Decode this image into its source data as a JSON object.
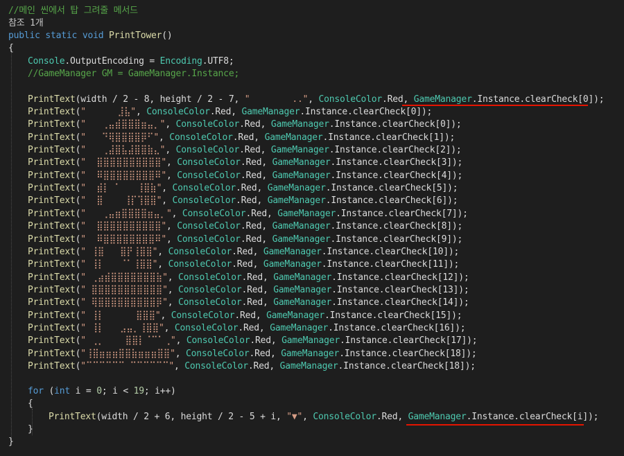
{
  "code": {
    "comment_header": "//메인 씬에서 탑 그려줄 메서드",
    "reference_count": "참조 1개",
    "signature": {
      "public": "public",
      "static": "static",
      "void": "void",
      "method": "PrintTower",
      "parens": "()"
    },
    "open_brace": "{",
    "close_brace": "}",
    "encoding_line": {
      "type": "Console",
      "mid": ".OutputEncoding = ",
      "enc": "Encoding",
      "tail": ".UTF8;"
    },
    "commented_gm": "//GameManager GM = GameManager.Instance;",
    "first_print": {
      "method": "PrintText",
      "args": "(width / 2 - 8, height / 2 - 7, ",
      "str": "\"        ..\"",
      "cc": "ConsoleColor",
      "red": ".Red, ",
      "gm": "GameManager",
      "tail": ".Instance.clearCheck[0]);"
    },
    "print_lines": [
      {
        "str": "\"      ⣸⣧\"",
        "idx": "0"
      },
      {
        "str": "\"   ⢀⣤⣾⣿⣿⣿⣶⣤⡀\"",
        "idx": "0"
      },
      {
        "str": "\"   ⠙⢿⣿⣿⣿⣿⡿⠋\"",
        "idx": "1"
      },
      {
        "str": "\"   ⢀⣼⣿⣧⣼⣿⣿⣷⣄\"",
        "idx": "2"
      },
      {
        "str": "\"  ⣿⣿⣿⣿⣿⣿⣿⣿⣿⣿\"",
        "idx": "3"
      },
      {
        "str": "\"  ⠿⣿⣿⣿⣿⣿⣿⣿⣿⠿\"",
        "idx": "4"
      },
      {
        "str": "\"  ⣾⡇ ⠁   ⢸⣿⣷\"",
        "idx": "5"
      },
      {
        "str": "\"  ⣿    ⢸⡏⢹⣿⣿\"",
        "idx": "6"
      },
      {
        "str": "\"   ⢀⣤⣶⣿⣿⣿⣿⣶⣤⡀\"",
        "idx": "7"
      },
      {
        "str": "\"  ⣿⣿⣿⣿⣿⣿⣿⣿⣿⣿\"",
        "idx": "8"
      },
      {
        "str": "\"  ⠿⣿⣿⣿⣿⣿⣿⣿⣿⠿\"",
        "idx": "9"
      },
      {
        "str": "\" ⢸⣿   ⣿⡟⢸⣿⣿\"",
        "idx": "10"
      },
      {
        "str": "\" ⢸⡇   ⠈⠁⢸⣿⣿\"",
        "idx": "11"
      },
      {
        "str": "\" ⢀⣴⣾⣿⣿⣿⣿⣿⣿⣿⣷\"",
        "idx": "12"
      },
      {
        "str": "\" ⣿⣿⣿⣿⣿⣿⣿⣿⣿⣿⣿\"",
        "idx": "13"
      },
      {
        "str": "\" ⢿⣿⣿⣿⣿⣿⣿⣿⣿⣿⡿\"",
        "idx": "14"
      },
      {
        "str": "\" ⢸⡇      ⣿⣿⣿\"",
        "idx": "15"
      },
      {
        "str": "\" ⢸⡇   ⣠⣤⡀⢸⣿⣿\"",
        "idx": "16"
      },
      {
        "str": "\" ⢀⡀    ⣿⣿⡇⠈⠉⠁⢀\"",
        "idx": "17"
      },
      {
        "str": "\"⢸⣿⣶⣶⣶⣿⣿⣷⣶⣶⣶⣿⣿\"",
        "idx": "18"
      },
      {
        "str": "\"⠉⠉⠉⠉⠉⠉ ⠉⠉⠉⠉⠉⠉\"",
        "idx": "18"
      }
    ],
    "print_method": "PrintText",
    "cc": "ConsoleColor",
    "red": ".Red, ",
    "gm": "GameManager",
    "instance_pre": ".Instance.clearCheck[",
    "instance_post": "]);",
    "for_line": {
      "for": "for",
      "int": "int",
      "rest_a": " i = ",
      "zero": "0",
      "rest_b": "; i < ",
      "nineteen": "19",
      "rest_c": "; i++)"
    },
    "inner_open": "{",
    "inner_close": "}",
    "loop_print": {
      "method": "PrintText",
      "args": "(width / 2 + 6, height / 2 - 5 + i, ",
      "str": "\"▼\"",
      "cc": "ConsoleColor",
      "red": ".Red, ",
      "gm": "GameManager",
      "tail": ".Instance.clearCheck[i]);"
    }
  },
  "colors": {
    "background": "#1e1e1e",
    "comment": "#57a64a",
    "keyword": "#569cd6",
    "type": "#4ec9b0",
    "method": "#dcdcaa",
    "string": "#d69d85",
    "underline": "#e51400"
  }
}
